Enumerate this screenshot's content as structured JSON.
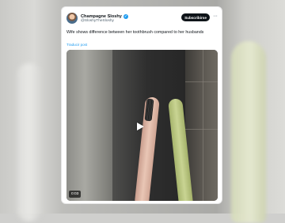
{
  "tweet": {
    "display_name": "Champagne Sloshy",
    "handle": "@SloshyTheSloshy",
    "subscribe_label": "Subscribirse",
    "more_glyph": "···",
    "verified_glyph": "✓",
    "text": "Wife shows difference between her toothbrush compared to her husbands",
    "translate_label": "Traducir post",
    "video": {
      "duration": "0:03",
      "play_icon": "play-icon"
    }
  },
  "colors": {
    "accent": "#1d9bf0",
    "button_bg": "#0f1419",
    "text_primary": "#0f1419",
    "text_secondary": "#536471"
  }
}
